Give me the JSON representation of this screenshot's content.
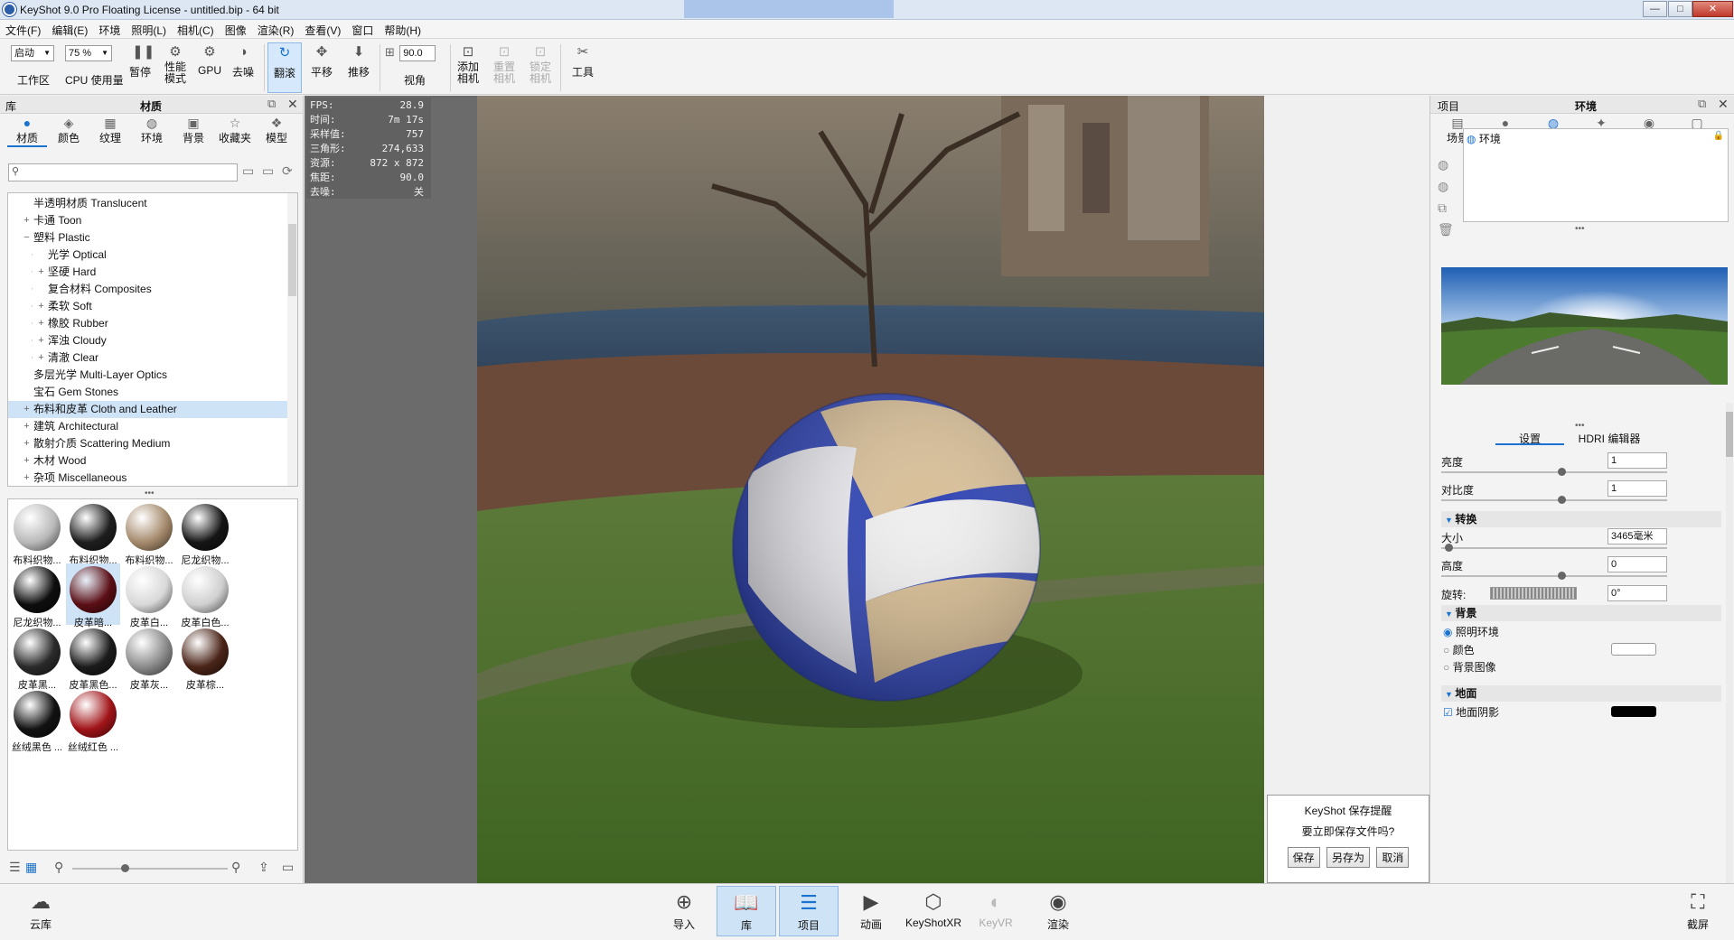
{
  "window": {
    "title": "KeyShot 9.0 Pro Floating License  - untitled.bip  - 64 bit",
    "minimize": "—",
    "maximize": "□",
    "close": "✕"
  },
  "menu": [
    "文件(F)",
    "编辑(E)",
    "环境",
    "照明(L)",
    "相机(C)",
    "图像",
    "渲染(R)",
    "查看(V)",
    "窗口",
    "帮助(H)"
  ],
  "toolbar": {
    "workspace_value": "启动",
    "workspace_label": "工作区",
    "cpu_value": "75 %",
    "cpu_label": "CPU 使用量",
    "pause_label": "暂停",
    "perf_label_1": "性能",
    "perf_label_2": "模式",
    "gpu_label": "GPU",
    "denoise_label": "去噪",
    "tumble_label": "翻滚",
    "pan_label": "平移",
    "dolly_label": "推移",
    "fov_value": "90.0",
    "fov_label": "视角",
    "add_cam_1": "添加",
    "add_cam_2": "相机",
    "reset_cam_1": "重置",
    "reset_cam_2": "相机",
    "lock_cam_1": "锁定",
    "lock_cam_2": "相机",
    "tools_label": "工具"
  },
  "left_panel": {
    "header_left": "库",
    "header_title": "材质",
    "tabs": [
      {
        "label": "材质",
        "icon": "material-icon"
      },
      {
        "label": "颜色",
        "icon": "color-icon"
      },
      {
        "label": "纹理",
        "icon": "texture-icon"
      },
      {
        "label": "环境",
        "icon": "environment-icon"
      },
      {
        "label": "背景",
        "icon": "background-icon"
      },
      {
        "label": "收藏夹",
        "icon": "favorites-icon"
      },
      {
        "label": "模型",
        "icon": "model-icon"
      }
    ],
    "tree": [
      {
        "pm": "",
        "label": "半透明材质 Translucent",
        "indent": 0
      },
      {
        "pm": "+",
        "label": "卡通 Toon",
        "indent": 0
      },
      {
        "pm": "−",
        "label": "塑料 Plastic",
        "indent": 0
      },
      {
        "pm": "",
        "label": "光学 Optical",
        "indent": 1
      },
      {
        "pm": "+",
        "label": "坚硬 Hard",
        "indent": 1
      },
      {
        "pm": "",
        "label": "复合材料 Composites",
        "indent": 1
      },
      {
        "pm": "+",
        "label": "柔软 Soft",
        "indent": 1
      },
      {
        "pm": "+",
        "label": "橡胶 Rubber",
        "indent": 1
      },
      {
        "pm": "+",
        "label": "浑浊 Cloudy",
        "indent": 1
      },
      {
        "pm": "+",
        "label": "清澈 Clear",
        "indent": 1
      },
      {
        "pm": "",
        "label": "多层光学 Multi-Layer Optics",
        "indent": 0
      },
      {
        "pm": "",
        "label": "宝石 Gem Stones",
        "indent": 0
      },
      {
        "pm": "+",
        "label": "布料和皮革 Cloth and Leather",
        "indent": 0,
        "selected": true
      },
      {
        "pm": "+",
        "label": "建筑 Architectural",
        "indent": 0
      },
      {
        "pm": "+",
        "label": "散射介质 Scattering Medium",
        "indent": 0
      },
      {
        "pm": "+",
        "label": "木材 Wood",
        "indent": 0
      },
      {
        "pm": "+",
        "label": "杂项 Miscellaneous",
        "indent": 0
      }
    ],
    "thumbnails": [
      {
        "label": "布料织物...",
        "color": "#b9b9b9"
      },
      {
        "label": "布料织物...",
        "color": "#1e1e1e"
      },
      {
        "label": "布料织物...",
        "color": "#a58a6c"
      },
      {
        "label": "尼龙织物...",
        "color": "#151515"
      },
      {
        "label": "尼龙织物...",
        "color": "#0e0e0e"
      },
      {
        "label": "皮革暗...",
        "color": "#5a0f15",
        "selected": true
      },
      {
        "label": "皮革白...",
        "color": "#d8d8d8"
      },
      {
        "label": "皮革白色...",
        "color": "#cfcfcf"
      },
      {
        "label": "皮革黑...",
        "color": "#2a2a2a"
      },
      {
        "label": "皮革黑色...",
        "color": "#1b1b1b"
      },
      {
        "label": "皮革灰...",
        "color": "#8a8a8a"
      },
      {
        "label": "皮革棕...",
        "color": "#4a2418"
      },
      {
        "label": "丝绒黑色 ...",
        "color": "#121212"
      },
      {
        "label": "丝绒红色 ...",
        "color": "#a01418"
      }
    ]
  },
  "hud": [
    {
      "k": "FPS:",
      "v": "28.9"
    },
    {
      "k": "时间:",
      "v": "7m 17s"
    },
    {
      "k": "采样值:",
      "v": "757"
    },
    {
      "k": "三角形:",
      "v": "274,633"
    },
    {
      "k": "资源:",
      "v": "872 x 872"
    },
    {
      "k": "焦距:",
      "v": "90.0"
    },
    {
      "k": "去噪:",
      "v": "关"
    }
  ],
  "save_dialog": {
    "title": "KeyShot 保存提醒",
    "question": "要立即保存文件吗?",
    "save": "保存",
    "save_as": "另存为",
    "cancel": "取消"
  },
  "right_panel": {
    "header_left": "项目",
    "header_title": "环境",
    "tabs": [
      {
        "label": "场景",
        "icon": "scene-icon"
      },
      {
        "label": "材质",
        "icon": "material-icon"
      },
      {
        "label": "环境",
        "icon": "environment-icon"
      },
      {
        "label": "照明",
        "icon": "lighting-icon"
      },
      {
        "label": "相机",
        "icon": "camera-icon"
      },
      {
        "label": "图像",
        "icon": "image-icon"
      }
    ],
    "env_item": "环境",
    "subtabs": {
      "settings": "设置",
      "hdri": "HDRI 编辑器"
    },
    "brightness_label": "亮度",
    "brightness_value": "1",
    "contrast_label": "对比度",
    "contrast_value": "1",
    "transform_header": "转换",
    "size_label": "大小",
    "size_value": "3465毫米",
    "height_label": "高度",
    "height_value": "0",
    "rotation_label": "旋转:",
    "rotation_value": "0°",
    "background_header": "背景",
    "bg_options": [
      "照明环境",
      "颜色",
      "背景图像"
    ],
    "ground_header": "地面",
    "ground_shadow": "地面阴影"
  },
  "bottom_bar": {
    "cloud": "云库",
    "import": "导入",
    "library": "库",
    "project": "项目",
    "animation": "动画",
    "keyshotxr": "KeyShotXR",
    "keyvr": "KeyVR",
    "render": "渲染",
    "screenshot": "截屏"
  }
}
